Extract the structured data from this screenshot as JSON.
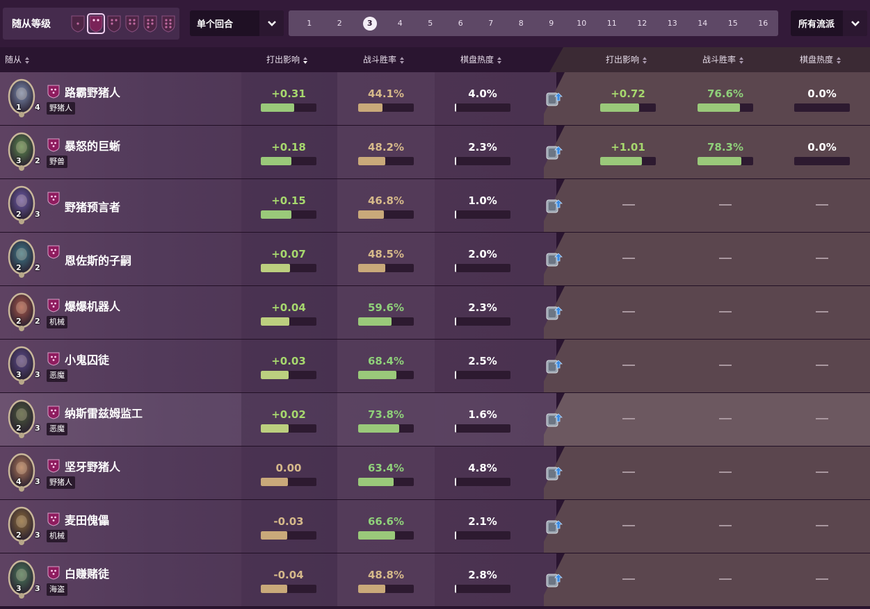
{
  "filters": {
    "tier_title": "随从等级",
    "tier_icons": [
      "tier-1",
      "tier-2",
      "tier-3",
      "tier-4",
      "tier-5",
      "tier-6"
    ],
    "selected_tier_index": 1,
    "turn_mode_label": "单个回合",
    "turns": [
      "1",
      "2",
      "3",
      "4",
      "5",
      "6",
      "7",
      "8",
      "9",
      "10",
      "11",
      "12",
      "13",
      "14",
      "15",
      "16"
    ],
    "selected_turn": "3",
    "archetype_label": "所有流派"
  },
  "columns": {
    "minion": "随从",
    "impact": "打出影响",
    "winrate": "战斗胜率",
    "popularity": "棋盘热度",
    "impact2": "打出影响",
    "winrate2": "战斗胜率",
    "popularity2": "棋盘热度"
  },
  "colors": {
    "green_bar": "#9ac97a",
    "lightgreen_bar": "#bccf7f",
    "tan_bar": "#c9a97a",
    "accent": "#8e1c5e"
  },
  "rows": [
    {
      "name": "路霸野猪人",
      "tribe": "野猪人",
      "attack": "1",
      "health": "4",
      "impact": "+0.31",
      "impact_level": 0.6,
      "winrate": "44.1%",
      "winrate_level": 0.441,
      "popularity": "4.0%",
      "pop_level": 0.04,
      "impact2": "+0.72",
      "impact2_level": 0.7,
      "winrate2": "76.6%",
      "winrate2_level": 0.766,
      "popularity2": "0.0%",
      "has_right": true,
      "portrait": "#7a8cb0"
    },
    {
      "name": "暴怒的巨蜥",
      "tribe": "野兽",
      "attack": "3",
      "health": "2",
      "impact": "+0.18",
      "impact_level": 0.55,
      "winrate": "48.2%",
      "winrate_level": 0.482,
      "popularity": "2.3%",
      "pop_level": 0.023,
      "impact2": "+1.01",
      "impact2_level": 0.75,
      "winrate2": "78.3%",
      "winrate2_level": 0.783,
      "popularity2": "0.0%",
      "has_right": true,
      "portrait": "#5c8a4e"
    },
    {
      "name": "野猪预言者",
      "tribe": "",
      "attack": "2",
      "health": "3",
      "impact": "+0.15",
      "impact_level": 0.55,
      "winrate": "46.8%",
      "winrate_level": 0.468,
      "popularity": "1.0%",
      "pop_level": 0.01,
      "has_right": false,
      "portrait": "#6c5aa8"
    },
    {
      "name": "恩佐斯的子嗣",
      "tribe": "",
      "attack": "2",
      "health": "2",
      "impact": "+0.07",
      "impact_level": 0.52,
      "winrate": "48.5%",
      "winrate_level": 0.485,
      "popularity": "2.0%",
      "pop_level": 0.02,
      "has_right": false,
      "portrait": "#3e7a8a"
    },
    {
      "name": "爆爆机器人",
      "tribe": "机械",
      "attack": "2",
      "health": "2",
      "impact": "+0.04",
      "impact_level": 0.51,
      "winrate": "59.6%",
      "winrate_level": 0.596,
      "popularity": "2.3%",
      "pop_level": 0.023,
      "has_right": false,
      "portrait": "#a8584a"
    },
    {
      "name": "小鬼囚徒",
      "tribe": "恶魔",
      "attack": "3",
      "health": "3",
      "impact": "+0.03",
      "impact_level": 0.5,
      "winrate": "68.4%",
      "winrate_level": 0.684,
      "popularity": "2.5%",
      "pop_level": 0.025,
      "has_right": false,
      "portrait": "#5a4a8a"
    },
    {
      "name": "纳斯雷兹姆监工",
      "tribe": "恶魔",
      "attack": "2",
      "health": "3",
      "impact": "+0.02",
      "impact_level": 0.5,
      "winrate": "73.8%",
      "winrate_level": 0.738,
      "popularity": "1.6%",
      "pop_level": 0.016,
      "has_right": false,
      "portrait": "#4a5a3a",
      "highlight": true
    },
    {
      "name": "坚牙野猪人",
      "tribe": "野猪人",
      "attack": "4",
      "health": "3",
      "impact": "0.00",
      "impact_level": 0.49,
      "winrate": "63.4%",
      "winrate_level": 0.634,
      "popularity": "4.8%",
      "pop_level": 0.048,
      "has_right": false,
      "portrait": "#b07a5a"
    },
    {
      "name": "麦田傀儡",
      "tribe": "机械",
      "attack": "2",
      "health": "3",
      "impact": "-0.03",
      "impact_level": 0.48,
      "winrate": "66.6%",
      "winrate_level": 0.666,
      "popularity": "2.1%",
      "pop_level": 0.021,
      "has_right": false,
      "portrait": "#8a6a3a"
    },
    {
      "name": "白赚赌徒",
      "tribe": "海盗",
      "attack": "3",
      "health": "3",
      "impact": "-0.04",
      "impact_level": 0.47,
      "winrate": "48.8%",
      "winrate_level": 0.488,
      "popularity": "2.8%",
      "pop_level": 0.028,
      "has_right": false,
      "portrait": "#4a7a5a"
    }
  ]
}
